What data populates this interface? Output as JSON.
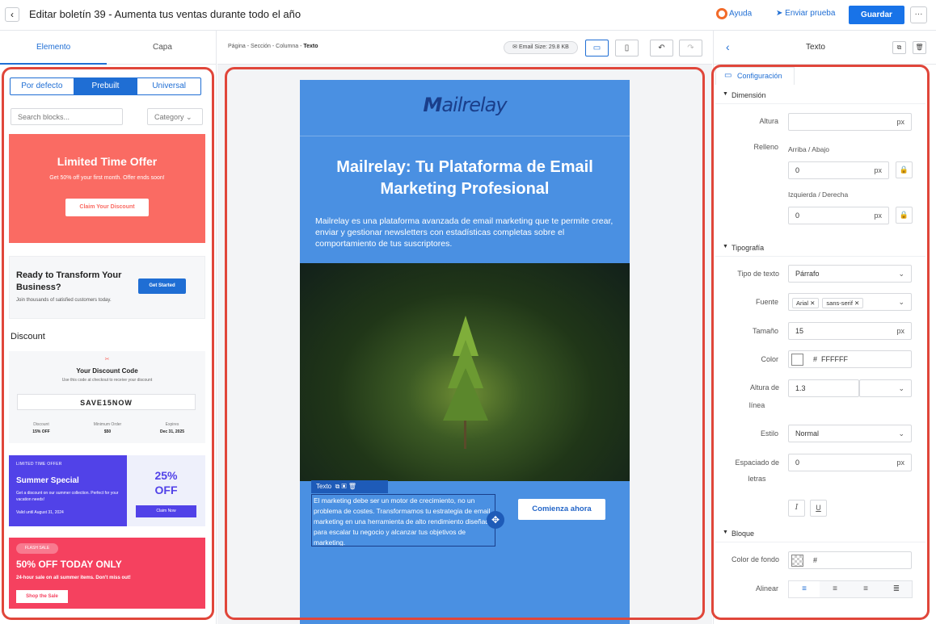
{
  "header": {
    "back_icon": "chevron-left",
    "title": "Editar boletín 39 - Aumenta tus ventas durante todo el año",
    "help_label": "Ayuda",
    "send_test_label": "Enviar prueba",
    "save_label": "Guardar",
    "more_label": "···"
  },
  "left_panel": {
    "tabs": [
      "Elemento",
      "Capa"
    ],
    "active_tab": "Elemento",
    "segments": [
      "Por defecto",
      "Prebuilt",
      "Universal"
    ],
    "active_segment": "Prebuilt",
    "search_placeholder": "Search blocks...",
    "category_label": "Category",
    "blocks": {
      "limited_offer": {
        "title": "Limited Time Offer",
        "subtitle": "Get 50% off your first month. Offer ends soon!",
        "button": "Claim Your Discount"
      },
      "transform": {
        "title": "Ready to Transform Your Business?",
        "subtitle": "Join thousands of satisfied customers today.",
        "button": "Get Started"
      },
      "discount_heading": "Discount",
      "discount_code": {
        "icon": "✂",
        "title": "Your Discount Code",
        "subtitle": "Use this code at checkout to receive your discount",
        "code": "SAVE15NOW",
        "cols": [
          {
            "label": "Discount",
            "value": "15% OFF"
          },
          {
            "label": "Minimum Order",
            "value": "$50"
          },
          {
            "label": "Expires",
            "value": "Dec 31, 2025"
          }
        ]
      },
      "summer": {
        "tag": "LIMITED TIME OFFER",
        "title": "Summer Special",
        "subtitle": "Get a discount on our summer collection. Perfect for your vacation needs!",
        "valid": "Valid until August 31, 2024",
        "pct": "25%",
        "off": "OFF",
        "button": "Claim Now"
      },
      "flash": {
        "pill": "FLASH SALE",
        "title": "50% OFF TODAY ONLY",
        "subtitle": "24-hour sale on all summer items. Don't miss out!",
        "button": "Shop the Sale"
      }
    }
  },
  "canvas": {
    "breadcrumb": {
      "path": "Página - Sección - Columna - ",
      "current": "Texto"
    },
    "email_size": "Email Size: 29.8 KB",
    "email": {
      "logo_prefix": "M",
      "logo_rest": "ailrelay",
      "heading": "Mailrelay: Tu Plataforma de Email Marketing Profesional",
      "paragraph": "Mailrelay es una plataforma avanzada de email marketing que te permite crear, enviar y gestionar newsletters con estadísticas completas sobre el comportamiento de tus suscriptores.",
      "selected_label": "Texto",
      "selected_text": "El marketing debe ser un motor de crecimiento, no un problema de costes. Transformamos tu estrategia de email marketing en una herramienta de alto rendimiento diseñada para escalar tu negocio y alcanzar tus objetivos de marketing.",
      "cta": "Comienza ahora"
    }
  },
  "right_panel": {
    "title": "Texto",
    "config_tab": "Configuración",
    "sections": {
      "dimension": "Dimensión",
      "typography": "Tipografía",
      "block": "Bloque"
    },
    "altura_label": "Altura",
    "altura_unit": "px",
    "relleno_label": "Relleno",
    "top_bottom_label": "Arriba / Abajo",
    "top_bottom_value": "0",
    "left_right_label": "Izquierda / Derecha",
    "left_right_value": "0",
    "text_type_label": "Tipo de texto",
    "text_type_value": "Párrafo",
    "font_label": "Fuente",
    "fonts": [
      "Arial",
      "sans-serif"
    ],
    "size_label": "Tamaño",
    "size_value": "15",
    "color_label": "Color",
    "color_hash": "#",
    "color_value": "FFFFFF",
    "line_height_label_1": "Altura de",
    "line_height_label_2": "línea",
    "line_height_value": "1.3",
    "style_label": "Estilo",
    "style_value": "Normal",
    "spacing_label_1": "Espaciado de",
    "spacing_label_2": "letras",
    "spacing_value": "0",
    "bg_color_label": "Color de fondo",
    "bg_color_hash": "#",
    "align_label": "Alinear"
  },
  "colors": {
    "accent": "#1873e8",
    "email_bg": "#4a90e2",
    "highlight": "#e0463a"
  }
}
